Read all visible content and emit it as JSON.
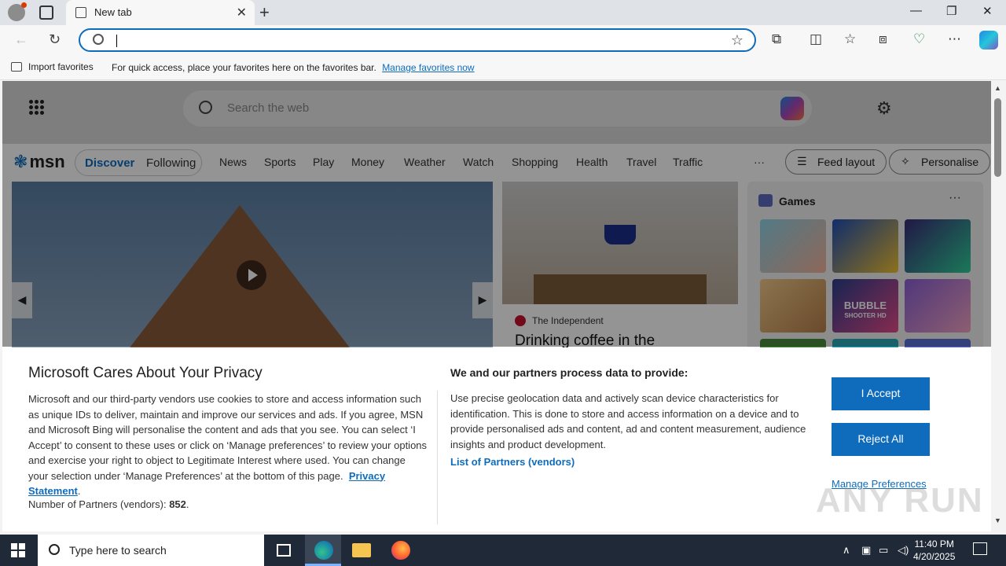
{
  "browser": {
    "tab_title": "New tab",
    "tab_close": "✕",
    "new_tab": "+",
    "win_min": "—",
    "win_max": "❐",
    "win_close": "✕",
    "back": "←",
    "refresh": "↻",
    "address_value": "",
    "fav_star": "☆",
    "toolbar_icons": [
      "extensions-icon",
      "split-screen-icon",
      "favorites-icon",
      "collections-icon",
      "browser-essentials-icon",
      "more-icon",
      "copilot-icon"
    ],
    "tb_extensions": "⧉",
    "tb_split": "◫",
    "tb_favorites": "☆",
    "tb_collections": "⧈",
    "tb_essentials": "♡",
    "tb_more": "⋯"
  },
  "favorites_bar": {
    "import_label": "Import favorites",
    "message": "For quick access, place your favorites here on the favorites bar.",
    "link": "Manage favorites now"
  },
  "msn": {
    "search_placeholder": "Search the web",
    "logo": "msn",
    "pill": {
      "discover": "Discover",
      "following": "Following"
    },
    "nav": [
      "News",
      "Sports",
      "Play",
      "Money",
      "Weather",
      "Watch",
      "Shopping",
      "Health",
      "Travel",
      "Traffic"
    ],
    "more": "···",
    "feed_layout": "Feed layout",
    "personalise": "Personalise",
    "hero_prev": "◀",
    "hero_next": "▶",
    "card": {
      "source": "The Independent",
      "headline": "Drinking coffee in the"
    },
    "games": {
      "title": "Games",
      "more": "···",
      "bubble_title": "BUBBLE",
      "bubble_sub": "SHOOTER HD"
    }
  },
  "privacy": {
    "title": "Microsoft Cares About Your Privacy",
    "body": "Microsoft and our third-party vendors use cookies to store and access information such as unique IDs to deliver, maintain and improve our services and ads. If you agree, MSN and Microsoft Bing will personalise the content and ads that you see. You can select ‘I Accept’ to consent to these uses or click on ‘Manage preferences’ to review your options and exercise your right to object to Legitimate Interest where used.  You can change your selection under ‘Manage Preferences’ at the bottom of this page.",
    "privacy_link": "Privacy Statement",
    "partners_label": "Number of Partners (vendors):",
    "partners_count": "852",
    "right_title": "We and our partners process data to provide:",
    "right_body": "Use precise geolocation data and actively scan device characteristics for identification. This is done to store and access information on a device and to provide personalised ads and content, ad and content measurement, audience insights and product development.",
    "list_link": "List of Partners (vendors)",
    "accept": "I Accept",
    "reject": "Reject All",
    "manage": "Manage Preferences"
  },
  "watermark": "ANY RUN",
  "taskbar": {
    "search_placeholder": "Type here to search",
    "time": "11:40 PM",
    "date": "4/20/2025",
    "tray_up": "∧"
  },
  "colors": {
    "accent": "#0f6cbd",
    "taskbar": "#1f2937"
  }
}
